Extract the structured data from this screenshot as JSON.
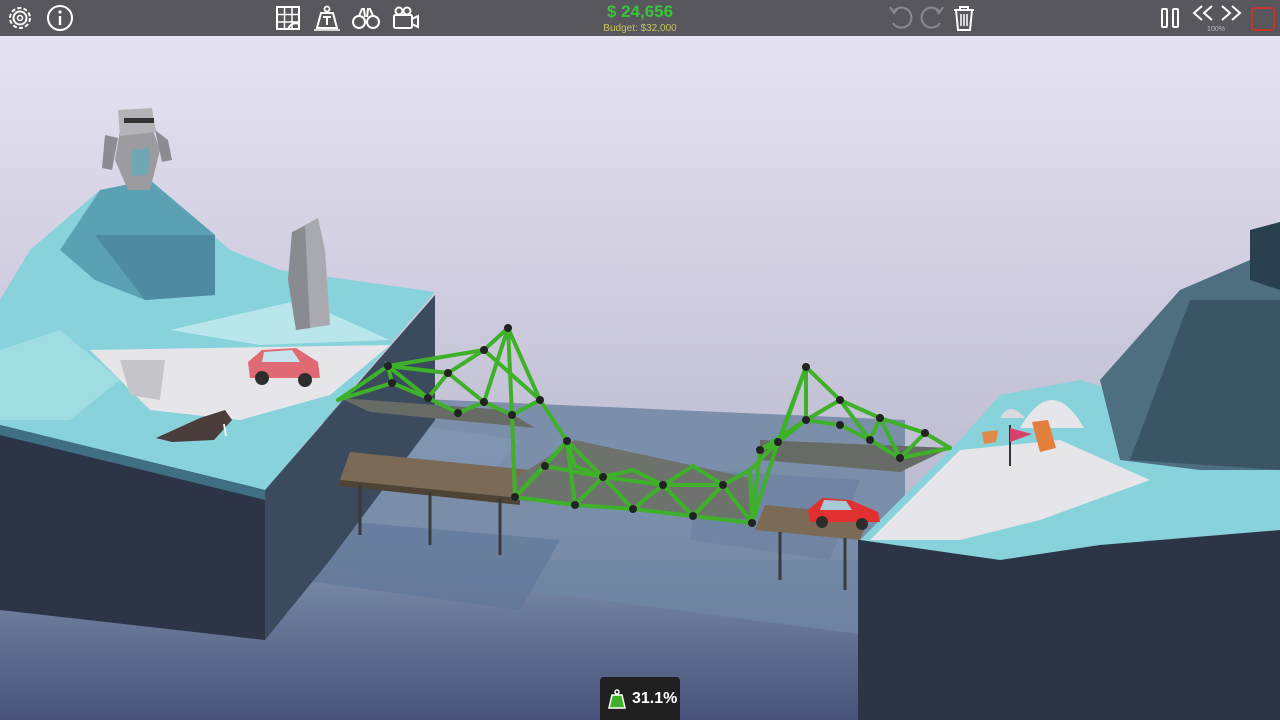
{
  "hud": {
    "money": "$ 24,656",
    "budget": "Budget: $32,000",
    "speed": "100%",
    "stress": "31.1%"
  },
  "toolbar": {
    "left": [
      "gear-icon",
      "info-icon"
    ],
    "center": [
      "materials-grid-icon",
      "load-weight-icon",
      "binoculars-icon",
      "camera-icon"
    ],
    "right": [
      "undo-icon",
      "redo-icon",
      "trash-icon",
      "pause-icon",
      "rewind-icon",
      "fast-forward-icon",
      "stop-icon"
    ]
  },
  "colors": {
    "topbar": "#57575d",
    "money": "#39c43a",
    "budget": "#c7c35a",
    "truss": "#3fb02a",
    "stop": "#c0392b",
    "stress_panel": "#202020"
  }
}
